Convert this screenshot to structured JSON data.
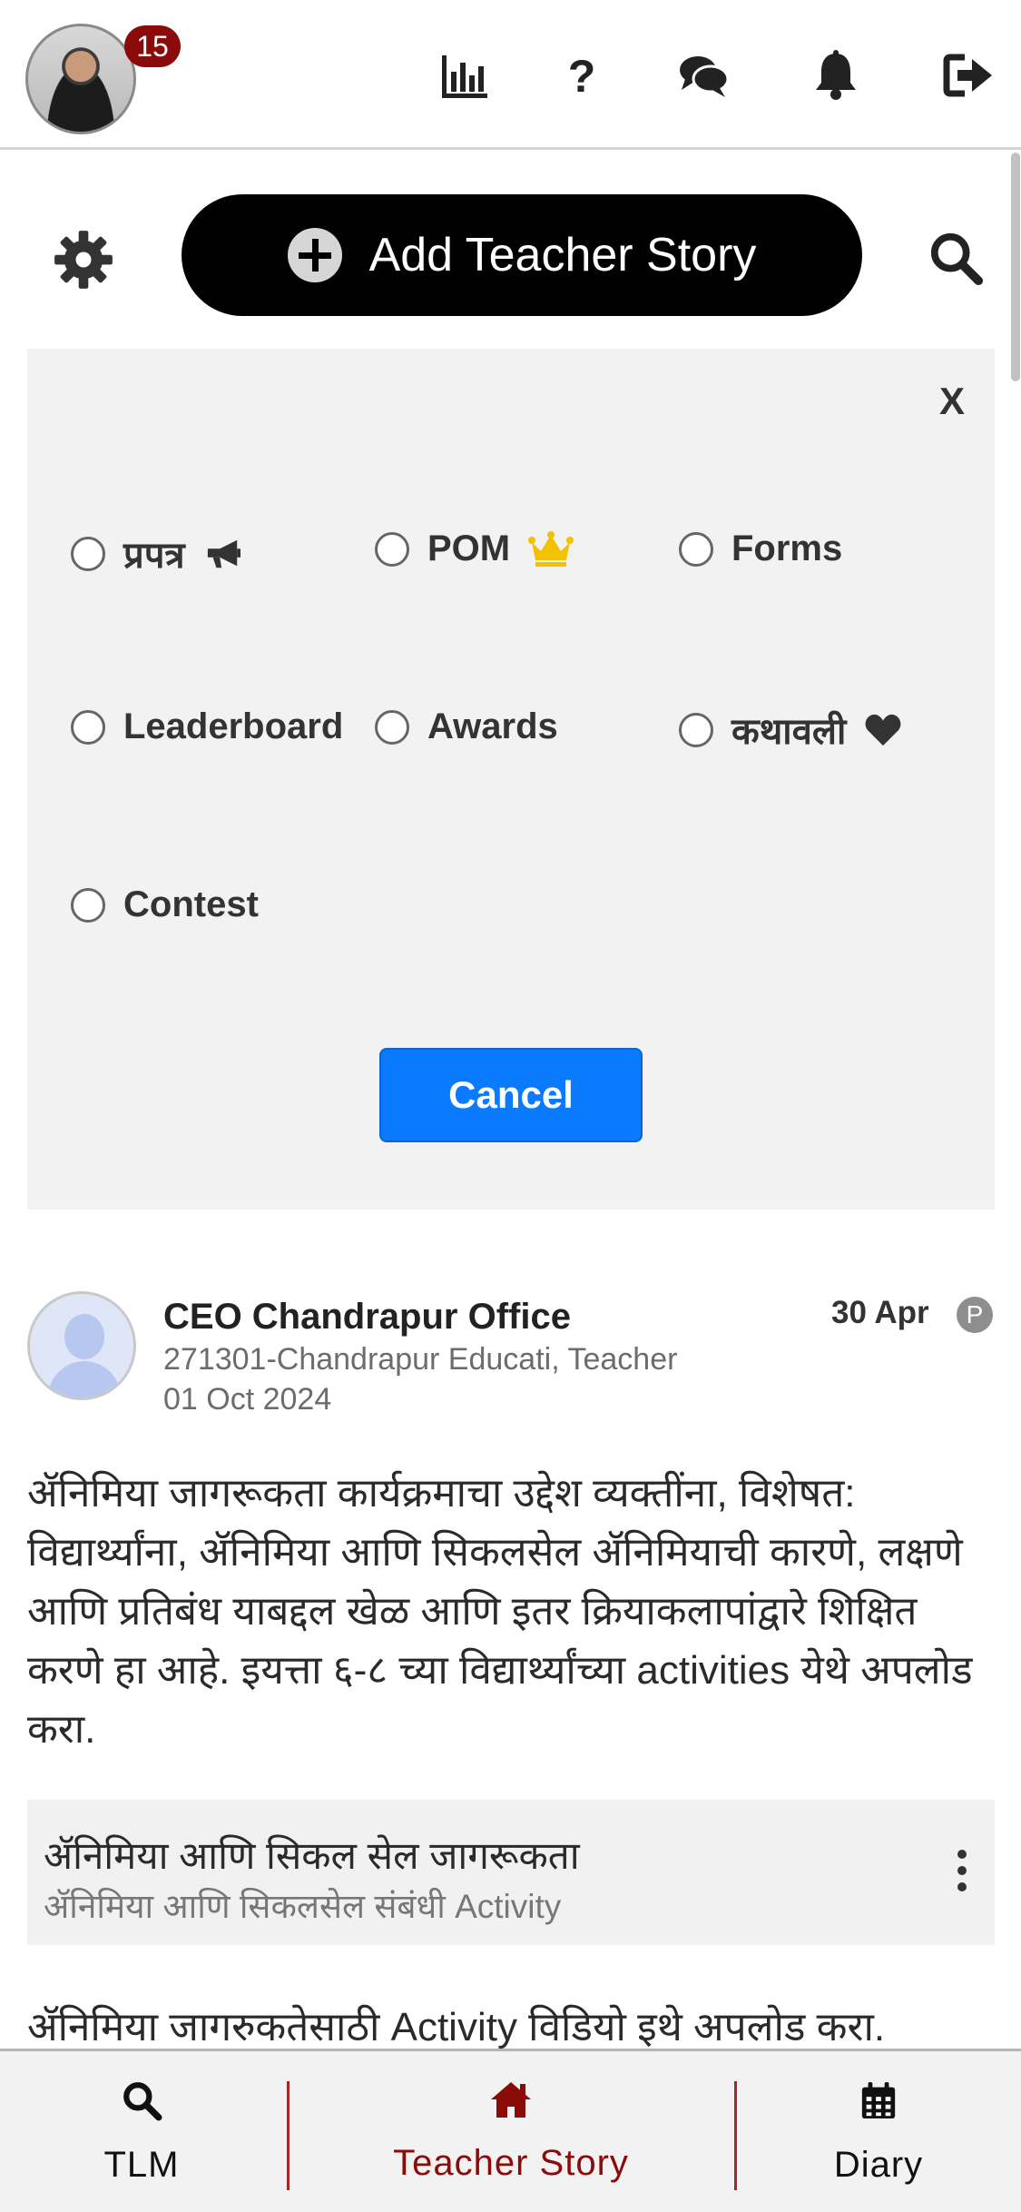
{
  "header": {
    "notification_count": "15",
    "icons": [
      "bar-chart-icon",
      "question-icon",
      "chat-icon",
      "bell-icon",
      "logout-icon"
    ]
  },
  "toolbar": {
    "add_story_label": "Add Teacher Story"
  },
  "filter_panel": {
    "close_label": "X",
    "options": [
      {
        "label": "प्रपत्र",
        "icon": "megaphone-icon"
      },
      {
        "label": "POM",
        "icon": "crown-icon"
      },
      {
        "label": "Forms",
        "icon": ""
      },
      {
        "label": "Leaderboard",
        "icon": ""
      },
      {
        "label": "Awards",
        "icon": ""
      },
      {
        "label": "कथावली",
        "icon": "heart-icon"
      },
      {
        "label": "Contest",
        "icon": ""
      }
    ],
    "cancel_label": "Cancel"
  },
  "post": {
    "author": "CEO Chandrapur Office",
    "subtitle": "271301-Chandrapur Educati, Teacher",
    "date": "01 Oct 2024",
    "time_ago": "30 Apr",
    "badge": "P",
    "body": "ॲनिमिया जागरूकता कार्यक्रमाचा उद्देश व्यक्तींना, विशेषत: विद्यार्थ्यांना, ॲनिमिया आणि सिकलसेल ॲनिमियाची कारणे, लक्षणे आणि प्रतिबंध याबद्दल खेळ आणि इतर क्रियाकलापांद्वारे शिक्षित करणे हा आहे. इयत्ता ६-८ च्या विद्यार्थ्यांच्या activities येथे अपलोड करा.",
    "attachment": {
      "title": "ॲनिमिया आणि सिकल सेल जागरूकता",
      "subtitle": "ॲनिमिया आणि सिकलसेल संबंधी Activity"
    },
    "footer_text": "ॲनिमिया जागरुकतेसाठी Activity विडियो इथे अपलोड करा."
  },
  "bottom_nav": {
    "items": [
      {
        "label": "TLM",
        "icon": "search-icon"
      },
      {
        "label": "Teacher Story",
        "icon": "home-icon",
        "active": true
      },
      {
        "label": "Diary",
        "icon": "calendar-icon"
      }
    ],
    "active_color": "#8b0a0a"
  },
  "colors": {
    "accent_blue": "#0a7bff",
    "badge_red": "#8b0a0a",
    "crown_gold": "#f2c200"
  }
}
